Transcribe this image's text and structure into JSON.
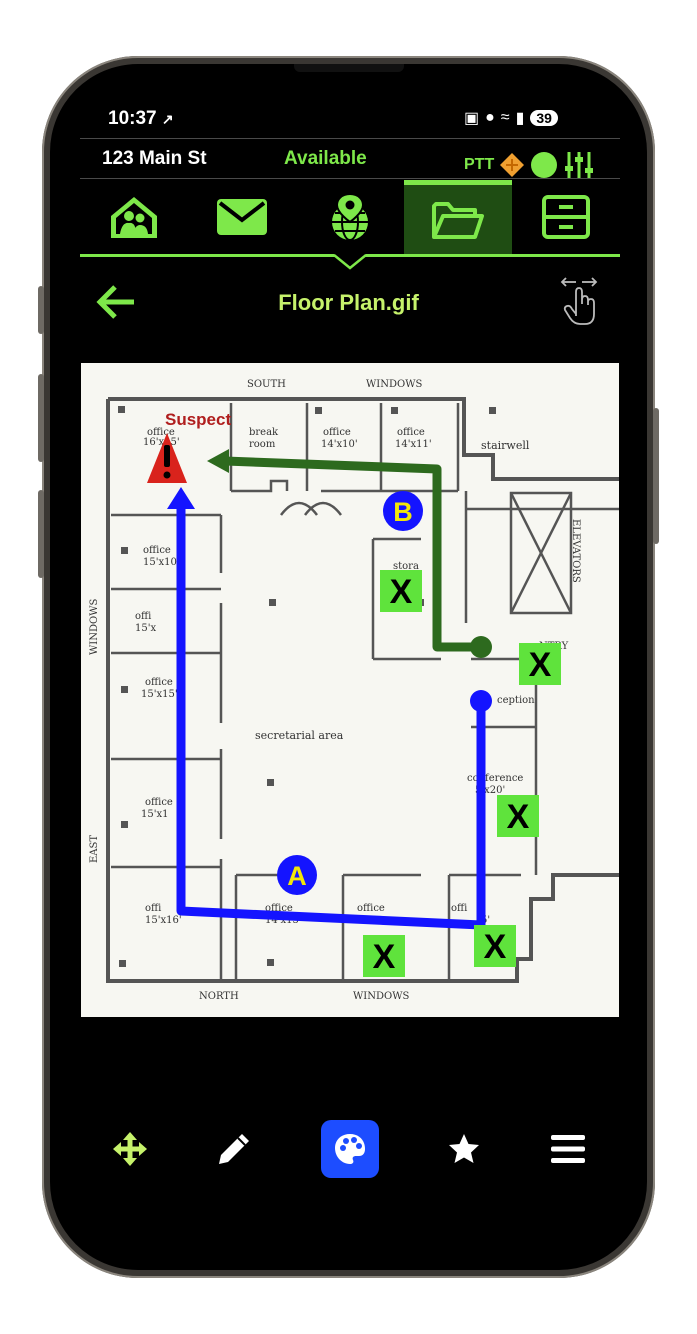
{
  "status_bar": {
    "time": "10:37",
    "battery": "39"
  },
  "header": {
    "address": "123 Main St",
    "availability": "Available",
    "ptt_label": "PTT"
  },
  "tabs": [
    {
      "icon": "family-icon"
    },
    {
      "icon": "mail-icon"
    },
    {
      "icon": "globe-pin-icon"
    },
    {
      "icon": "folder-open-icon",
      "active": true
    },
    {
      "icon": "cabinet-icon"
    }
  ],
  "title_bar": {
    "title": "Floor Plan.gif"
  },
  "floor_plan": {
    "labels": {
      "south": "SOUTH",
      "windows_top": "WINDOWS",
      "windows_left": "WINDOWS",
      "windows_bottom": "WINDOWS",
      "north": "NORTH",
      "east": "EAST",
      "elevators": "ELEVATORS",
      "stairwell": "stairwell",
      "office_a": "office",
      "office_a_size": "16'x15'",
      "break": "break",
      "break2": "room",
      "office_b": "office",
      "office_b_size": "14'x10'",
      "office_c": "office",
      "office_c_size": "14'x11'",
      "office_d": "office",
      "office_d_size": "15'x10'",
      "office_e": "offi",
      "office_e_size": "15'x",
      "office_f": "office",
      "office_f_size": "15'x15'",
      "office_g": "office",
      "office_g_size": "15'x1",
      "office_h": "offi",
      "office_h_size": "15'x16'",
      "office_i": "office",
      "office_i_size": "14'x15'",
      "office_j": "office",
      "office_k": "offi",
      "office_k_size": "5'",
      "storage": "stora",
      "secretarial": "secretarial area",
      "reception": "ception",
      "conference": "conference",
      "conference_size": "5'x20'",
      "entry": "NTRY"
    },
    "annotations": {
      "suspect_label": "Suspect",
      "marker_a": "A",
      "marker_b": "B",
      "x_mark": "X",
      "blue_route_color": "#1414ff",
      "green_route_color": "#2d6a1e",
      "x_box_color": "#5fe33c",
      "alert_color": "#d9231c"
    }
  },
  "toolbar": [
    {
      "icon": "move-icon"
    },
    {
      "icon": "pencil-icon"
    },
    {
      "icon": "palette-icon",
      "active": true
    },
    {
      "icon": "star-icon"
    },
    {
      "icon": "menu-icon"
    }
  ],
  "colors": {
    "accent": "#7ee84a",
    "title": "#c6f26b",
    "active_tab_bg": "#1f4d13",
    "active_tool": "#1d4dff"
  }
}
